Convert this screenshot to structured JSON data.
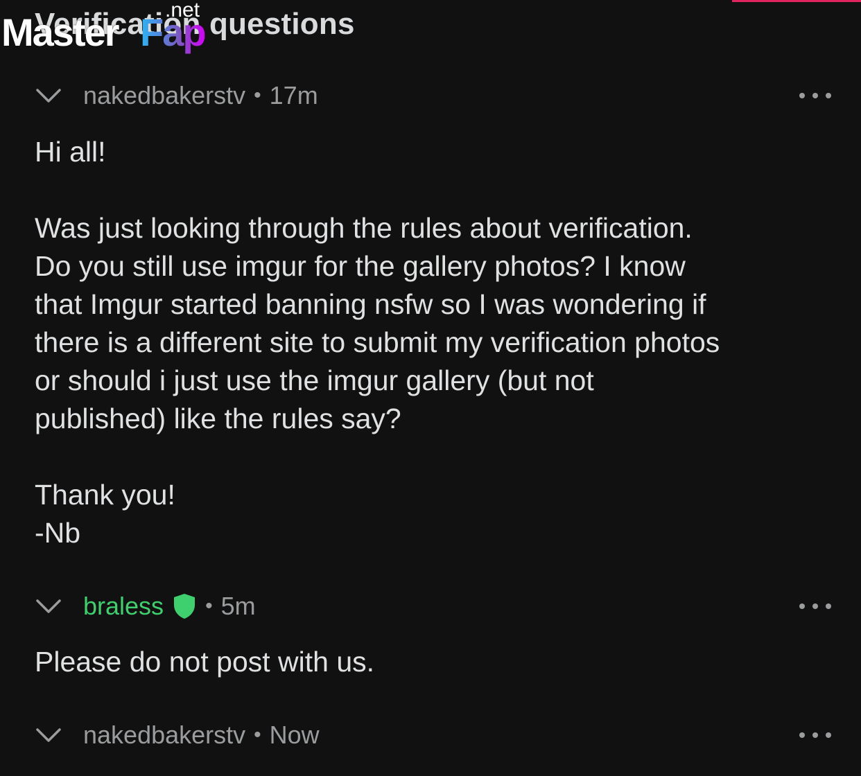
{
  "header": {
    "title": "Verification questions"
  },
  "watermark": {
    "master": "Master",
    "fap": "Fap",
    "net": ".net"
  },
  "colors": {
    "background": "#111112",
    "text": "#dfe1e2",
    "meta": "#9a9c9e",
    "moderator": "#3ecf6e",
    "accent": "#e0245e"
  },
  "comments": [
    {
      "username": "nakedbakerstv",
      "time": "17m",
      "lines": [
        "Hi all!",
        "Was just looking through the rules about verification.",
        "Do you still use imgur for the gallery photos? I know",
        "that Imgur started banning nsfw so I was wondering if",
        "there is a different site to submit my verification photos",
        "or should i just use the imgur gallery (but not",
        "published) like the rules say?",
        "Thank you!",
        "-Nb"
      ]
    },
    {
      "username": "braless",
      "badge_icon": "shield-icon",
      "time": "5m",
      "lines": [
        "Please do not post with us."
      ]
    },
    {
      "username": "nakedbakerstv",
      "time": "Now"
    }
  ],
  "icons": {
    "collapse": "chevron-down-icon",
    "more": "more-options-icon",
    "moderator": "shield-icon"
  }
}
